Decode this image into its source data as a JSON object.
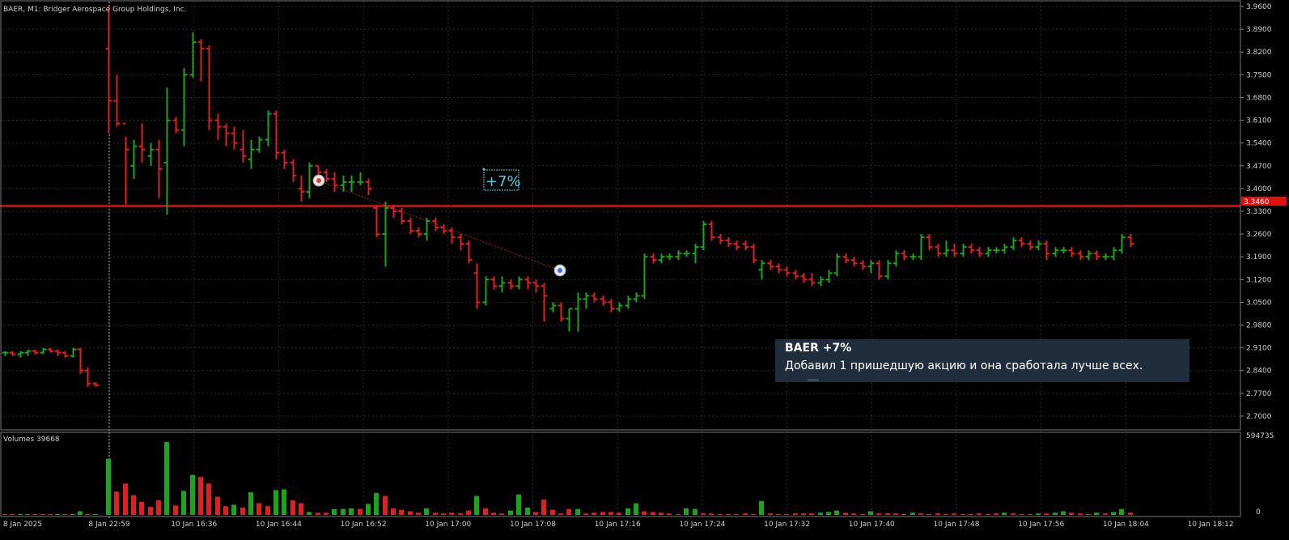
{
  "chart_title": "BAER, M1:  Bridger Aerospace Group Holdings, Inc.",
  "volume_label": "Volumes 39668",
  "price_axis": {
    "ticks": [
      "3.9600",
      "3.8900",
      "3.8200",
      "3.7500",
      "3.6800",
      "3.6100",
      "3.5400",
      "3.4700",
      "3.4000",
      "3.3300",
      "3.2600",
      "3.1900",
      "3.1200",
      "3.0500",
      "2.9800",
      "2.9100",
      "2.8400",
      "2.7700",
      "2.7000"
    ],
    "current_price_tag": "3.3460"
  },
  "volume_axis": {
    "max_label": "594735",
    "min_label": "0"
  },
  "time_axis": {
    "labels": [
      "8 Jan 2025",
      "8 Jan 22:59",
      "10 Jan 16:36",
      "10 Jan 16:44",
      "10 Jan 16:52",
      "10 Jan 17:00",
      "10 Jan 17:08",
      "10 Jan 17:16",
      "10 Jan 17:24",
      "10 Jan 17:32",
      "10 Jan 17:40",
      "10 Jan 17:48",
      "10 Jan 17:56",
      "10 Jan 18:04",
      "10 Jan 18:12"
    ]
  },
  "annotation": {
    "label": "+7%"
  },
  "tooltip": {
    "title": "BAER +7%",
    "text": "Добавил 1 пришедшую акцию и она сработала лучше всех."
  },
  "colors": {
    "background": "#000000",
    "grid": "#2a2a2a",
    "bull": "#1aa51a",
    "bear": "#e02020",
    "level_line": "#e01010",
    "axis_text": "#cfcfcf",
    "annotation": "#4fd0e0",
    "tooltip_bg": "#1f2d3d"
  },
  "chart_data": {
    "type": "ohlc",
    "symbol": "BAER",
    "timeframe": "M1",
    "horizontal_level": 3.346,
    "ylim": [
      2.66,
      3.975
    ],
    "bars": [
      [
        2.895,
        2.9,
        2.885,
        2.895
      ],
      [
        2.895,
        2.9,
        2.885,
        2.89
      ],
      [
        2.89,
        2.9,
        2.88,
        2.895
      ],
      [
        2.895,
        2.905,
        2.885,
        2.9
      ],
      [
        2.9,
        2.905,
        2.89,
        2.895
      ],
      [
        2.895,
        2.91,
        2.89,
        2.905
      ],
      [
        2.905,
        2.91,
        2.895,
        2.9
      ],
      [
        2.9,
        2.905,
        2.885,
        2.895
      ],
      [
        2.895,
        2.9,
        2.88,
        2.885
      ],
      [
        2.885,
        2.91,
        2.88,
        2.905
      ],
      [
        2.905,
        2.91,
        2.83,
        2.84
      ],
      [
        2.84,
        2.85,
        2.79,
        2.8
      ],
      [
        2.8,
        2.805,
        2.79,
        2.795
      ],
      [
        3.83,
        3.96,
        3.57,
        3.67
      ],
      [
        3.67,
        3.75,
        3.59,
        3.6
      ],
      [
        3.6,
        3.56,
        3.35,
        3.52
      ],
      [
        3.47,
        3.55,
        3.43,
        3.53
      ],
      [
        3.53,
        3.6,
        3.48,
        3.52
      ],
      [
        3.5,
        3.54,
        3.47,
        3.52
      ],
      [
        3.52,
        3.55,
        3.37,
        3.46
      ],
      [
        3.48,
        3.71,
        3.32,
        3.61
      ],
      [
        3.61,
        3.62,
        3.57,
        3.58
      ],
      [
        3.58,
        3.77,
        3.53,
        3.75
      ],
      [
        3.75,
        3.88,
        3.74,
        3.85
      ],
      [
        3.85,
        3.86,
        3.73,
        3.83
      ],
      [
        3.83,
        3.84,
        3.58,
        3.61
      ],
      [
        3.61,
        3.63,
        3.55,
        3.59
      ],
      [
        3.59,
        3.6,
        3.53,
        3.57
      ],
      [
        3.57,
        3.59,
        3.52,
        3.54
      ],
      [
        3.52,
        3.58,
        3.48,
        3.5
      ],
      [
        3.49,
        3.55,
        3.46,
        3.52
      ],
      [
        3.52,
        3.56,
        3.51,
        3.55
      ],
      [
        3.55,
        3.64,
        3.53,
        3.63
      ],
      [
        3.63,
        3.64,
        3.49,
        3.51
      ],
      [
        3.51,
        3.52,
        3.46,
        3.48
      ],
      [
        3.48,
        3.49,
        3.42,
        3.44
      ],
      [
        3.4,
        3.44,
        3.36,
        3.39
      ],
      [
        3.39,
        3.48,
        3.37,
        3.47
      ],
      [
        3.47,
        3.47,
        3.43,
        3.45
      ],
      [
        3.45,
        3.46,
        3.42,
        3.43
      ],
      [
        3.43,
        3.45,
        3.39,
        3.41
      ],
      [
        3.41,
        3.44,
        3.39,
        3.42
      ],
      [
        3.42,
        3.44,
        3.39,
        3.42
      ],
      [
        3.42,
        3.45,
        3.41,
        3.42
      ],
      [
        3.42,
        3.43,
        3.38,
        3.4
      ],
      [
        3.34,
        3.35,
        3.25,
        3.26
      ],
      [
        3.26,
        3.36,
        3.16,
        3.34
      ],
      [
        3.34,
        3.35,
        3.31,
        3.33
      ],
      [
        3.33,
        3.34,
        3.29,
        3.3
      ],
      [
        3.3,
        3.31,
        3.26,
        3.27
      ],
      [
        3.27,
        3.28,
        3.25,
        3.26
      ],
      [
        3.26,
        3.31,
        3.24,
        3.3
      ],
      [
        3.3,
        3.31,
        3.27,
        3.28
      ],
      [
        3.28,
        3.29,
        3.26,
        3.27
      ],
      [
        3.27,
        3.28,
        3.23,
        3.25
      ],
      [
        3.25,
        3.26,
        3.21,
        3.23
      ],
      [
        3.23,
        3.24,
        3.17,
        3.18
      ],
      [
        3.14,
        3.17,
        3.03,
        3.05
      ],
      [
        3.05,
        3.13,
        3.04,
        3.12
      ],
      [
        3.12,
        3.13,
        3.09,
        3.1
      ],
      [
        3.1,
        3.13,
        3.08,
        3.11
      ],
      [
        3.11,
        3.12,
        3.09,
        3.1
      ],
      [
        3.1,
        3.13,
        3.09,
        3.12
      ],
      [
        3.12,
        3.13,
        3.09,
        3.11
      ],
      [
        3.11,
        3.12,
        3.08,
        3.1
      ],
      [
        3.1,
        3.11,
        2.99,
        3.07
      ],
      [
        3.03,
        3.05,
        3.02,
        3.04
      ],
      [
        3.04,
        3.05,
        2.99,
        3.0
      ],
      [
        3.0,
        3.03,
        2.96,
        3.03
      ],
      [
        3.03,
        3.08,
        2.96,
        3.06
      ],
      [
        3.06,
        3.08,
        3.03,
        3.07
      ],
      [
        3.07,
        3.08,
        3.05,
        3.06
      ],
      [
        3.06,
        3.07,
        3.04,
        3.05
      ],
      [
        3.05,
        3.06,
        3.02,
        3.03
      ],
      [
        3.03,
        3.05,
        3.02,
        3.04
      ],
      [
        3.04,
        3.07,
        3.03,
        3.06
      ],
      [
        3.06,
        3.08,
        3.05,
        3.07
      ],
      [
        3.07,
        3.2,
        3.06,
        3.19
      ],
      [
        3.19,
        3.2,
        3.17,
        3.18
      ],
      [
        3.18,
        3.2,
        3.17,
        3.19
      ],
      [
        3.19,
        3.2,
        3.18,
        3.19
      ],
      [
        3.19,
        3.21,
        3.18,
        3.2
      ],
      [
        3.2,
        3.21,
        3.19,
        3.2
      ],
      [
        3.2,
        3.23,
        3.17,
        3.22
      ],
      [
        3.22,
        3.3,
        3.21,
        3.29
      ],
      [
        3.29,
        3.3,
        3.24,
        3.25
      ],
      [
        3.25,
        3.26,
        3.23,
        3.24
      ],
      [
        3.24,
        3.25,
        3.22,
        3.23
      ],
      [
        3.23,
        3.24,
        3.21,
        3.22
      ],
      [
        3.23,
        3.24,
        3.21,
        3.22
      ],
      [
        3.22,
        3.23,
        3.17,
        3.18
      ],
      [
        3.15,
        3.18,
        3.12,
        3.17
      ],
      [
        3.17,
        3.18,
        3.15,
        3.16
      ],
      [
        3.16,
        3.17,
        3.14,
        3.15
      ],
      [
        3.15,
        3.16,
        3.13,
        3.14
      ],
      [
        3.14,
        3.15,
        3.12,
        3.13
      ],
      [
        3.13,
        3.14,
        3.11,
        3.12
      ],
      [
        3.12,
        3.14,
        3.1,
        3.11
      ],
      [
        3.11,
        3.13,
        3.1,
        3.12
      ],
      [
        3.12,
        3.15,
        3.11,
        3.14
      ],
      [
        3.14,
        3.2,
        3.13,
        3.19
      ],
      [
        3.19,
        3.2,
        3.17,
        3.18
      ],
      [
        3.18,
        3.19,
        3.16,
        3.17
      ],
      [
        3.17,
        3.18,
        3.15,
        3.16
      ],
      [
        3.16,
        3.18,
        3.14,
        3.17
      ],
      [
        3.17,
        3.18,
        3.12,
        3.13
      ],
      [
        3.13,
        3.18,
        3.12,
        3.17
      ],
      [
        3.17,
        3.21,
        3.16,
        3.2
      ],
      [
        3.2,
        3.21,
        3.18,
        3.19
      ],
      [
        3.19,
        3.2,
        3.18,
        3.19
      ],
      [
        3.19,
        3.26,
        3.18,
        3.25
      ],
      [
        3.25,
        3.26,
        3.21,
        3.22
      ],
      [
        3.22,
        3.23,
        3.19,
        3.2
      ],
      [
        3.2,
        3.24,
        3.19,
        3.21
      ],
      [
        3.21,
        3.23,
        3.19,
        3.2
      ],
      [
        3.2,
        3.23,
        3.19,
        3.22
      ],
      [
        3.22,
        3.23,
        3.2,
        3.21
      ],
      [
        3.21,
        3.22,
        3.19,
        3.2
      ],
      [
        3.2,
        3.22,
        3.19,
        3.21
      ],
      [
        3.21,
        3.22,
        3.2,
        3.21
      ],
      [
        3.21,
        3.23,
        3.2,
        3.22
      ],
      [
        3.22,
        3.25,
        3.21,
        3.24
      ],
      [
        3.24,
        3.25,
        3.22,
        3.23
      ],
      [
        3.23,
        3.24,
        3.21,
        3.22
      ],
      [
        3.22,
        3.24,
        3.21,
        3.23
      ],
      [
        3.23,
        3.24,
        3.18,
        3.2
      ],
      [
        3.2,
        3.22,
        3.19,
        3.21
      ],
      [
        3.21,
        3.22,
        3.2,
        3.21
      ],
      [
        3.21,
        3.22,
        3.19,
        3.2
      ],
      [
        3.2,
        3.21,
        3.18,
        3.19
      ],
      [
        3.19,
        3.21,
        3.18,
        3.2
      ],
      [
        3.2,
        3.21,
        3.18,
        3.19
      ],
      [
        3.19,
        3.2,
        3.18,
        3.19
      ],
      [
        3.19,
        3.22,
        3.18,
        3.21
      ],
      [
        3.21,
        3.26,
        3.2,
        3.25
      ],
      [
        3.25,
        3.26,
        3.22,
        3.23
      ]
    ],
    "volume_scale_max": 594735
  },
  "volumes": [
    {
      "v": 0.01,
      "up": false
    },
    {
      "v": 0.01,
      "up": false
    },
    {
      "v": 0.01,
      "up": true
    },
    {
      "v": 0.01,
      "up": true
    },
    {
      "v": 0.01,
      "up": false
    },
    {
      "v": 0.01,
      "up": false
    },
    {
      "v": 0.01,
      "up": false
    },
    {
      "v": 0.01,
      "up": true
    },
    {
      "v": 0.01,
      "up": false
    },
    {
      "v": 0.01,
      "up": true
    },
    {
      "v": 0.05,
      "up": true
    },
    {
      "v": 0.01,
      "up": false
    },
    {
      "v": 0.01,
      "up": true
    },
    {
      "v": 0.77,
      "up": true
    },
    {
      "v": 0.32,
      "up": false
    },
    {
      "v": 0.43,
      "up": false
    },
    {
      "v": 0.27,
      "up": false
    },
    {
      "v": 0.18,
      "up": false
    },
    {
      "v": 0.11,
      "up": false
    },
    {
      "v": 0.2,
      "up": false
    },
    {
      "v": 1.0,
      "up": true
    },
    {
      "v": 0.13,
      "up": false
    },
    {
      "v": 0.33,
      "up": true
    },
    {
      "v": 0.55,
      "up": true
    },
    {
      "v": 0.52,
      "up": false
    },
    {
      "v": 0.43,
      "up": false
    },
    {
      "v": 0.25,
      "up": false
    },
    {
      "v": 0.12,
      "up": false
    },
    {
      "v": 0.14,
      "up": true
    },
    {
      "v": 0.1,
      "up": false
    },
    {
      "v": 0.31,
      "up": true
    },
    {
      "v": 0.16,
      "up": false
    },
    {
      "v": 0.12,
      "up": false
    },
    {
      "v": 0.34,
      "up": true
    },
    {
      "v": 0.35,
      "up": true
    },
    {
      "v": 0.2,
      "up": false
    },
    {
      "v": 0.16,
      "up": false
    },
    {
      "v": 0.04,
      "up": true
    },
    {
      "v": 0.03,
      "up": false
    },
    {
      "v": 0.03,
      "up": false
    },
    {
      "v": 0.08,
      "up": true
    },
    {
      "v": 0.08,
      "up": true
    },
    {
      "v": 0.09,
      "up": true
    },
    {
      "v": 0.08,
      "up": false
    },
    {
      "v": 0.15,
      "up": true
    },
    {
      "v": 0.3,
      "up": true
    },
    {
      "v": 0.26,
      "up": false
    },
    {
      "v": 0.09,
      "up": false
    },
    {
      "v": 0.07,
      "up": false
    },
    {
      "v": 0.05,
      "up": false
    },
    {
      "v": 0.03,
      "up": false
    },
    {
      "v": 0.09,
      "up": true
    },
    {
      "v": 0.03,
      "up": false
    },
    {
      "v": 0.02,
      "up": false
    },
    {
      "v": 0.03,
      "up": false
    },
    {
      "v": 0.02,
      "up": false
    },
    {
      "v": 0.06,
      "up": false
    },
    {
      "v": 0.26,
      "up": true
    },
    {
      "v": 0.09,
      "up": false
    },
    {
      "v": 0.03,
      "up": false
    },
    {
      "v": 0.02,
      "up": false
    },
    {
      "v": 0.06,
      "up": true
    },
    {
      "v": 0.28,
      "up": true
    },
    {
      "v": 0.1,
      "up": true
    },
    {
      "v": 0.04,
      "up": false
    },
    {
      "v": 0.21,
      "up": false
    },
    {
      "v": 0.07,
      "up": false
    },
    {
      "v": 0.02,
      "up": false
    },
    {
      "v": 0.08,
      "up": false
    },
    {
      "v": 0.08,
      "up": true
    },
    {
      "v": 0.02,
      "up": false
    },
    {
      "v": 0.03,
      "up": false
    },
    {
      "v": 0.04,
      "up": false
    },
    {
      "v": 0.04,
      "up": false
    },
    {
      "v": 0.03,
      "up": false
    },
    {
      "v": 0.09,
      "up": true
    },
    {
      "v": 0.16,
      "up": true
    },
    {
      "v": 0.05,
      "up": false
    },
    {
      "v": 0.04,
      "up": false
    },
    {
      "v": 0.03,
      "up": false
    },
    {
      "v": 0.02,
      "up": false
    },
    {
      "v": 0.01,
      "up": false
    },
    {
      "v": 0.09,
      "up": true
    },
    {
      "v": 0.08,
      "up": true
    },
    {
      "v": 0.02,
      "up": false
    },
    {
      "v": 0.02,
      "up": false
    },
    {
      "v": 0.01,
      "up": false
    },
    {
      "v": 0.01,
      "up": false
    },
    {
      "v": 0.01,
      "up": false
    },
    {
      "v": 0.02,
      "up": false
    },
    {
      "v": 0.01,
      "up": false
    },
    {
      "v": 0.19,
      "up": true
    },
    {
      "v": 0.02,
      "up": false
    },
    {
      "v": 0.01,
      "up": false
    },
    {
      "v": 0.01,
      "up": false
    },
    {
      "v": 0.02,
      "up": false
    },
    {
      "v": 0.02,
      "up": false
    },
    {
      "v": 0.02,
      "up": false
    },
    {
      "v": 0.03,
      "up": true
    },
    {
      "v": 0.04,
      "up": true
    },
    {
      "v": 0.06,
      "up": true
    },
    {
      "v": 0.03,
      "up": false
    },
    {
      "v": 0.02,
      "up": false
    },
    {
      "v": 0.01,
      "up": false
    },
    {
      "v": 0.05,
      "up": true
    },
    {
      "v": 0.02,
      "up": false
    },
    {
      "v": 0.02,
      "up": false
    },
    {
      "v": 0.02,
      "up": false
    },
    {
      "v": 0.01,
      "up": false
    },
    {
      "v": 0.03,
      "up": true
    },
    {
      "v": 0.02,
      "up": false
    },
    {
      "v": 0.01,
      "up": false
    },
    {
      "v": 0.02,
      "up": false
    },
    {
      "v": 0.01,
      "up": false
    },
    {
      "v": 0.02,
      "up": false
    },
    {
      "v": 0.01,
      "up": false
    },
    {
      "v": 0.01,
      "up": false
    },
    {
      "v": 0.02,
      "up": false
    },
    {
      "v": 0.01,
      "up": false
    },
    {
      "v": 0.02,
      "up": false
    },
    {
      "v": 0.03,
      "up": true
    },
    {
      "v": 0.02,
      "up": false
    },
    {
      "v": 0.01,
      "up": false
    },
    {
      "v": 0.01,
      "up": false
    },
    {
      "v": 0.02,
      "up": true
    },
    {
      "v": 0.02,
      "up": false
    },
    {
      "v": 0.03,
      "up": true
    },
    {
      "v": 0.05,
      "up": true
    },
    {
      "v": 0.03,
      "up": false
    },
    {
      "v": 0.02,
      "up": false
    },
    {
      "v": 0.01,
      "up": false
    },
    {
      "v": 0.03,
      "up": true
    },
    {
      "v": 0.02,
      "up": false
    },
    {
      "v": 0.04,
      "up": true
    },
    {
      "v": 0.08,
      "up": true
    },
    {
      "v": 0.03,
      "up": false
    }
  ]
}
